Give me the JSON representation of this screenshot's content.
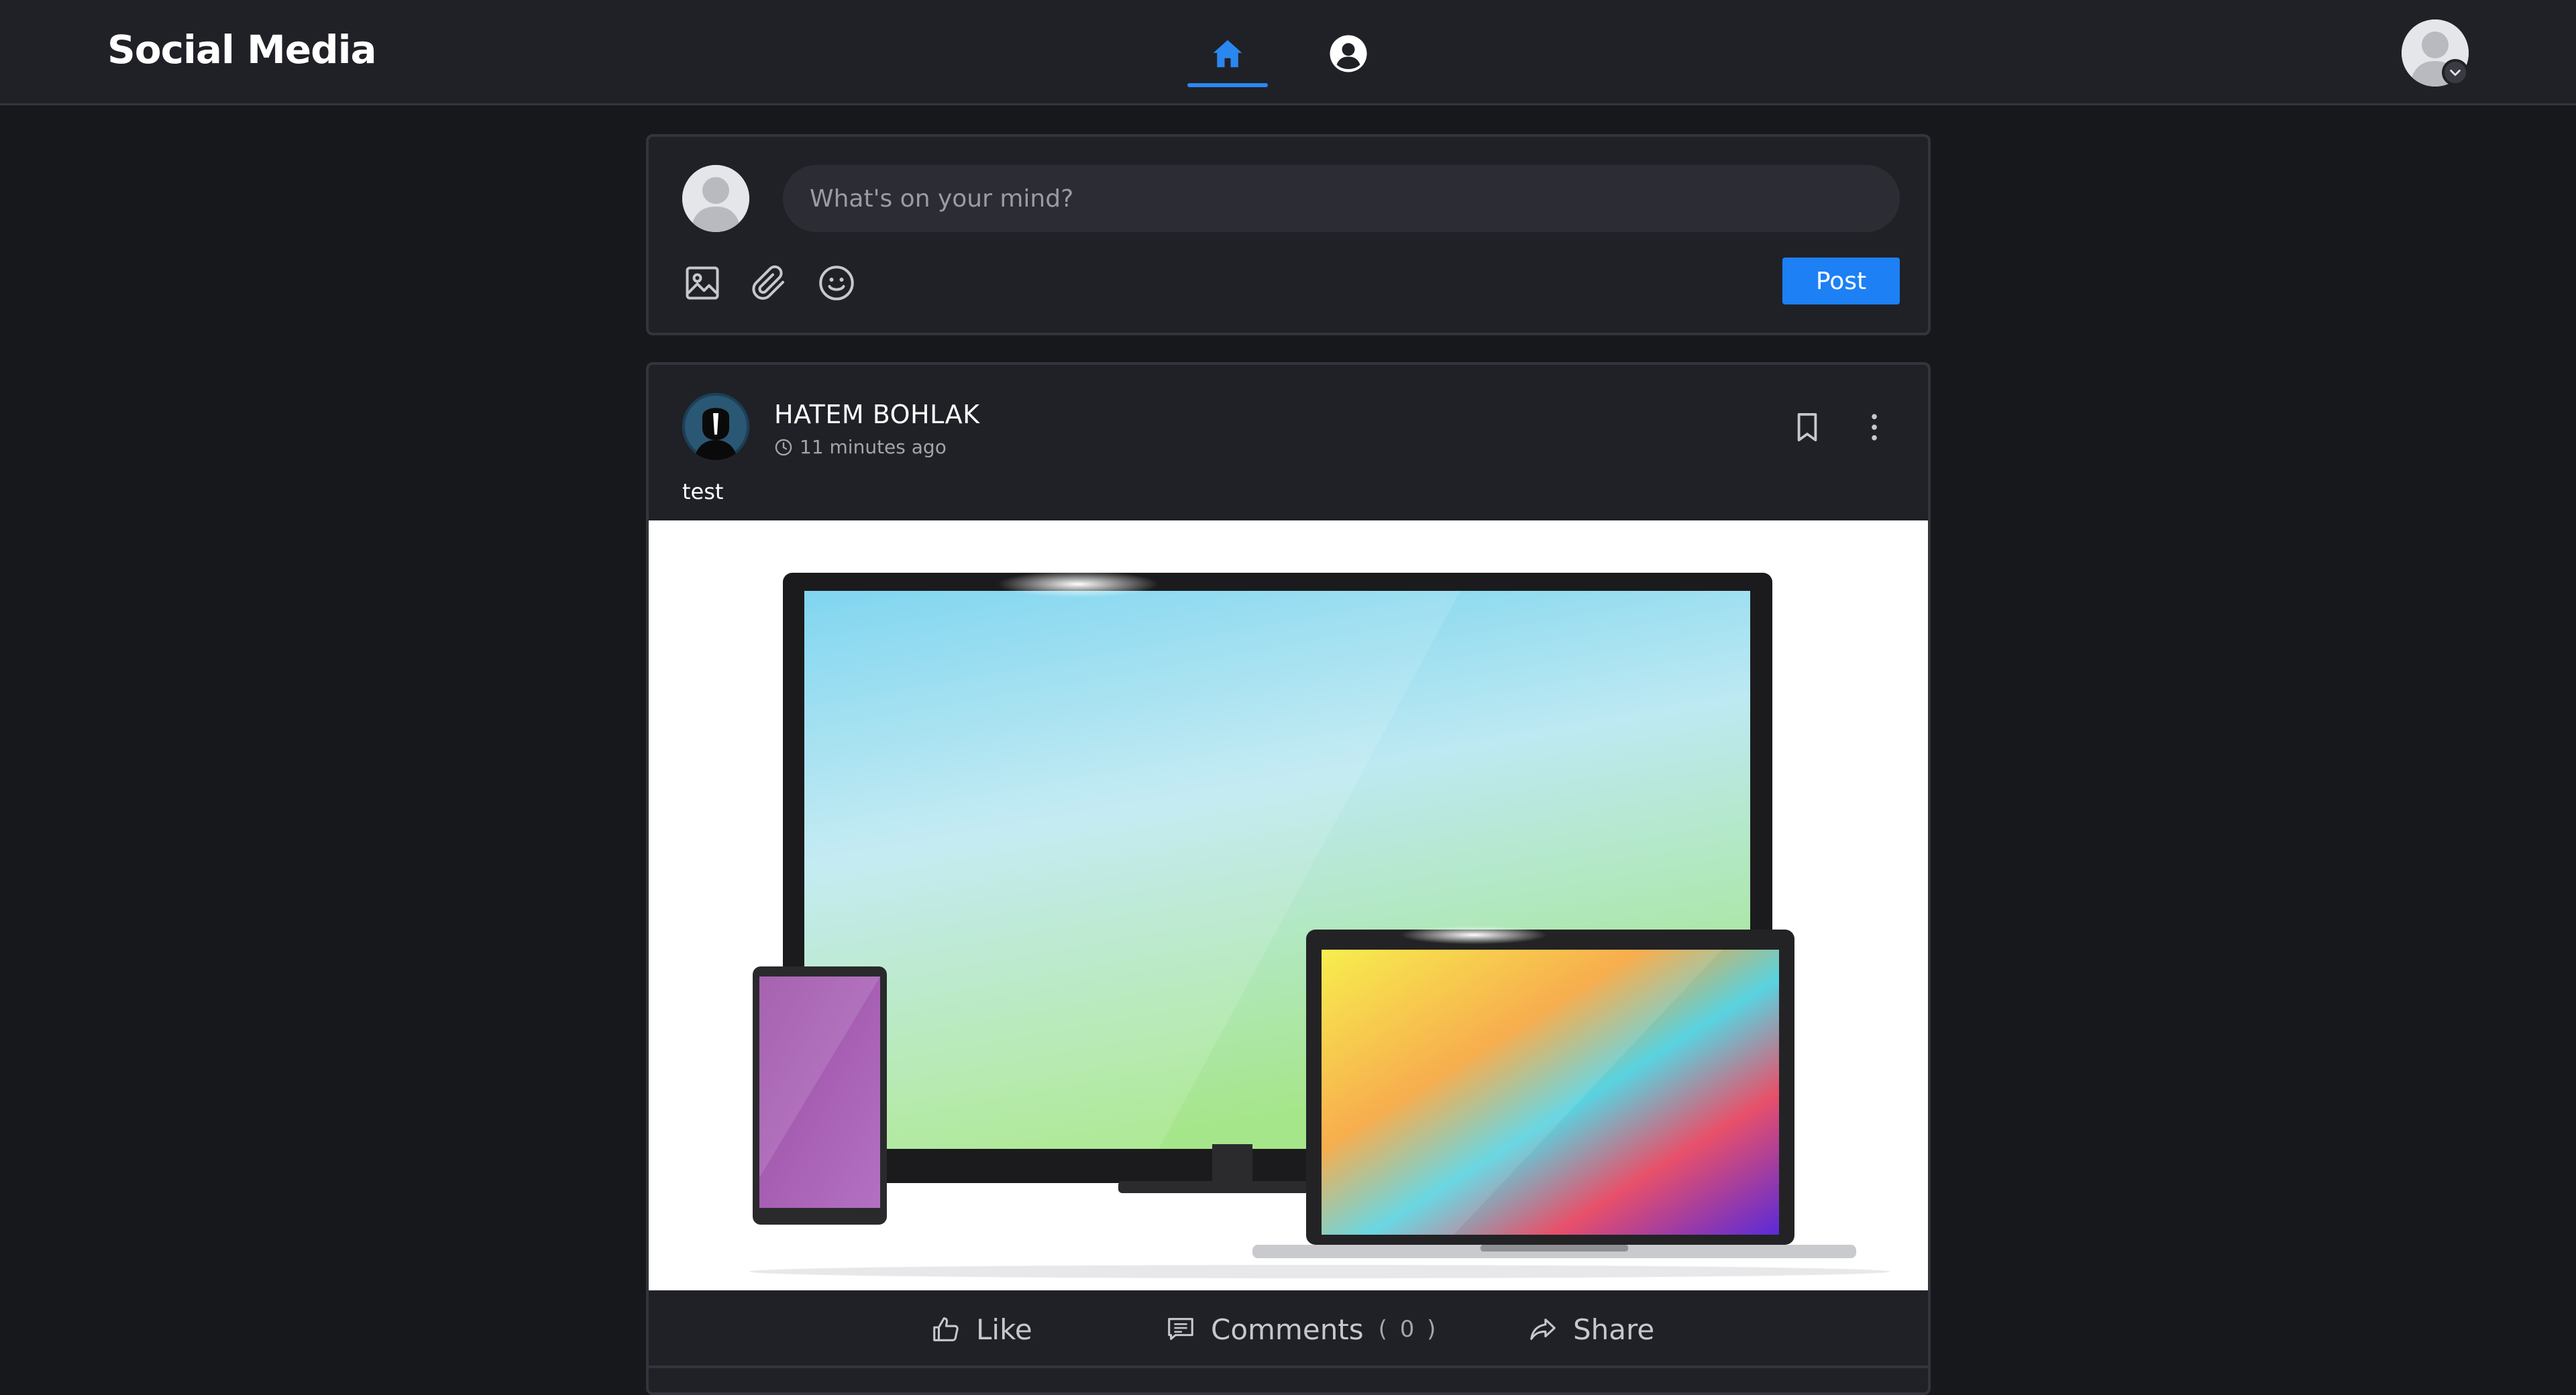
{
  "header": {
    "brand": "Social Media",
    "nav": [
      {
        "name": "home",
        "icon": "home-icon",
        "active": true
      },
      {
        "name": "profile",
        "icon": "user-circle-icon",
        "active": false
      }
    ],
    "accent_color": "#2b87f0"
  },
  "composer": {
    "placeholder": "What's on your mind?",
    "tools": [
      "image-icon",
      "paperclip-icon",
      "emoji-icon"
    ],
    "post_label": "Post"
  },
  "post": {
    "author": "HATEM BOHLAK",
    "time": "11 minutes ago",
    "text": "test",
    "actions": {
      "like_label": "Like",
      "comments_label": "Comments",
      "comments_count": "( 0 )",
      "share_label": "Share"
    }
  }
}
